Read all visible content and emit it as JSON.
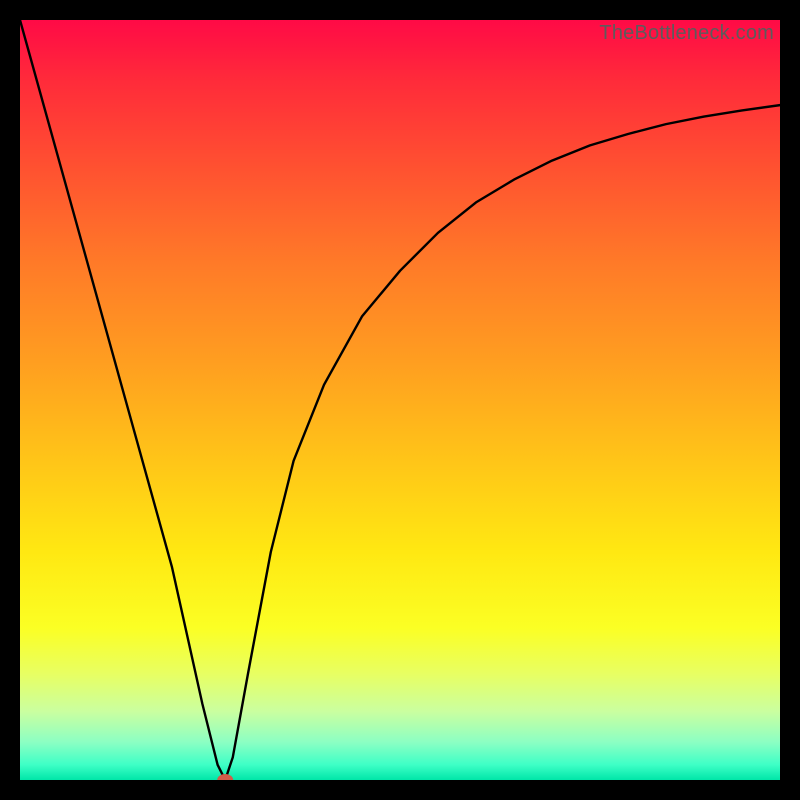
{
  "watermark": "TheBottleneck.com",
  "chart_data": {
    "type": "line",
    "title": "",
    "xlabel": "",
    "ylabel": "",
    "xlim": [
      0,
      100
    ],
    "ylim": [
      0,
      100
    ],
    "grid": false,
    "legend": false,
    "series": [
      {
        "name": "bottleneck-curve",
        "x": [
          0,
          5,
          10,
          15,
          20,
          24,
          26,
          27,
          28,
          30,
          33,
          36,
          40,
          45,
          50,
          55,
          60,
          65,
          70,
          75,
          80,
          85,
          90,
          95,
          100
        ],
        "y": [
          100,
          82,
          64,
          46,
          28,
          10,
          2,
          0,
          3,
          14,
          30,
          42,
          52,
          61,
          67,
          72,
          76,
          79,
          81.5,
          83.5,
          85,
          86.3,
          87.3,
          88.1,
          88.8
        ]
      }
    ],
    "markers": [
      {
        "name": "min-point",
        "x": 27,
        "y": 0,
        "color": "#d15c4a"
      }
    ],
    "background_gradient": {
      "direction": "vertical",
      "stops": [
        {
          "pos": 0.0,
          "color": "#ff0a46"
        },
        {
          "pos": 0.5,
          "color": "#ffc518"
        },
        {
          "pos": 0.8,
          "color": "#fbff24"
        },
        {
          "pos": 1.0,
          "color": "#00e6a8"
        }
      ]
    }
  }
}
